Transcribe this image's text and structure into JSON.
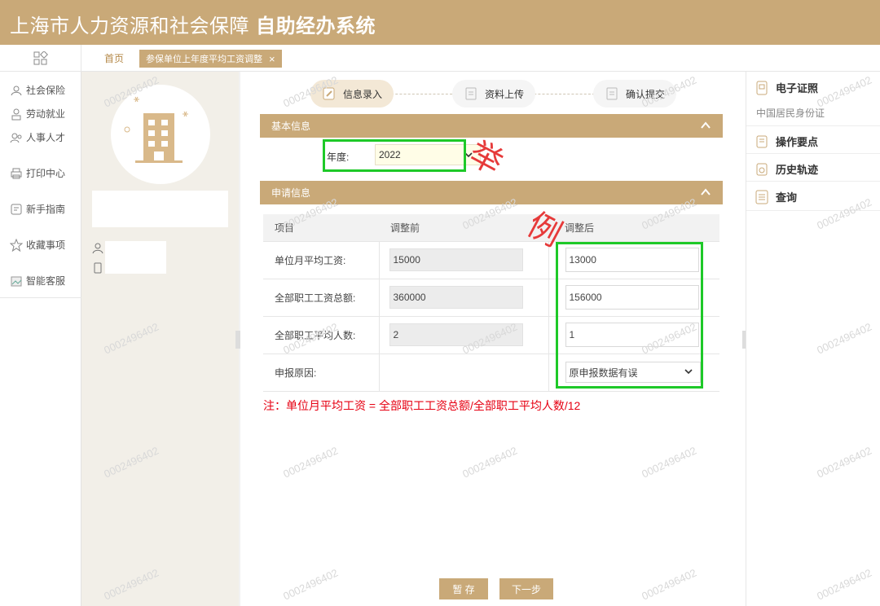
{
  "header": {
    "title_part1": "上海市人力资源和社会保障",
    "title_part2": "自助经办系统"
  },
  "tabs": {
    "home": "首页",
    "active": "参保单位上年度平均工资调整",
    "close": "×"
  },
  "sidebar": {
    "items": [
      {
        "label": "社会保险",
        "icon": "social-insurance-icon"
      },
      {
        "label": "劳动就业",
        "icon": "employment-icon"
      },
      {
        "label": "人事人才",
        "icon": "talent-icon"
      },
      {
        "label": "打印中心",
        "icon": "printer-icon"
      },
      {
        "label": "新手指南",
        "icon": "guide-icon"
      },
      {
        "label": "收藏事项",
        "icon": "star-icon"
      },
      {
        "label": "智能客服",
        "icon": "customer-service-icon"
      }
    ]
  },
  "steps": [
    {
      "label": "信息录入",
      "state": "active"
    },
    {
      "label": "资料上传",
      "state": "inactive"
    },
    {
      "label": "确认提交",
      "state": "inactive"
    }
  ],
  "basic": {
    "heading": "基本信息",
    "year_label": "年度:",
    "year_value": "2022"
  },
  "apply": {
    "heading": "申请信息",
    "columns": [
      "项目",
      "调整前",
      "调整后"
    ],
    "rows": [
      {
        "item": "单位月平均工资:",
        "before": "15000",
        "after": "13000"
      },
      {
        "item": "全部职工工资总额:",
        "before": "360000",
        "after": "156000"
      },
      {
        "item": "全部职工平均人数:",
        "before": "2",
        "after": "1"
      }
    ],
    "reason_label": "申报原因:",
    "reason_value": "原申报数据有误"
  },
  "note": "注：单位月平均工资 = 全部职工工资总额/全部职工平均人数/12",
  "buttons": {
    "save": "暂 存",
    "next": "下一步"
  },
  "stamp": {
    "char1": "举",
    "char2": "例"
  },
  "right_panel": {
    "e_license": "电子证照",
    "e_license_sub": "中国居民身份证",
    "key_points": "操作要点",
    "history": "历史轨迹",
    "query": "查询"
  },
  "watermark": "0002496402",
  "colors": {
    "brand": "#c9a978",
    "highlight": "#1ec928",
    "note": "#e60012"
  }
}
